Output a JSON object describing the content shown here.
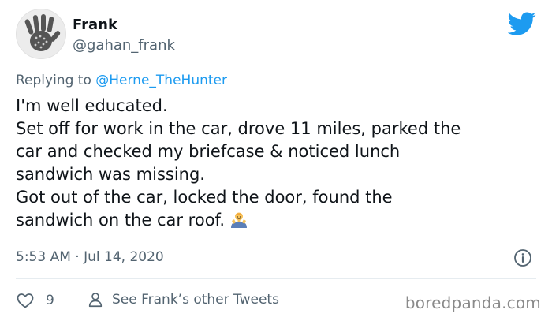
{
  "author": {
    "display_name": "Frank",
    "handle": "@gahan_frank",
    "avatar_icon": "handprint-avatar"
  },
  "brand": {
    "icon": "twitter-bird-icon",
    "color": "#1d9bf0"
  },
  "reply": {
    "prefix": "Replying to",
    "mention": "@Herne_TheHunter"
  },
  "tweet": {
    "lines": [
      "I'm well educated.",
      "Set off for work in the car, drove 11 miles, parked the",
      "car and checked my briefcase & noticed lunch",
      "sandwich was missing.",
      "Got out of the car, locked the door, found the",
      "sandwich on the car roof."
    ],
    "emoji": "man-shrugging-emoji",
    "timestamp": "5:53 AM · Jul 14, 2020"
  },
  "actions": {
    "like_count": "9",
    "profile_link": "See Frank’s other Tweets"
  },
  "watermark": "boredpanda.com",
  "colors": {
    "text": "#0f1419",
    "muted": "#536471",
    "link": "#1d9bf0",
    "divider": "#e6ecf0"
  }
}
